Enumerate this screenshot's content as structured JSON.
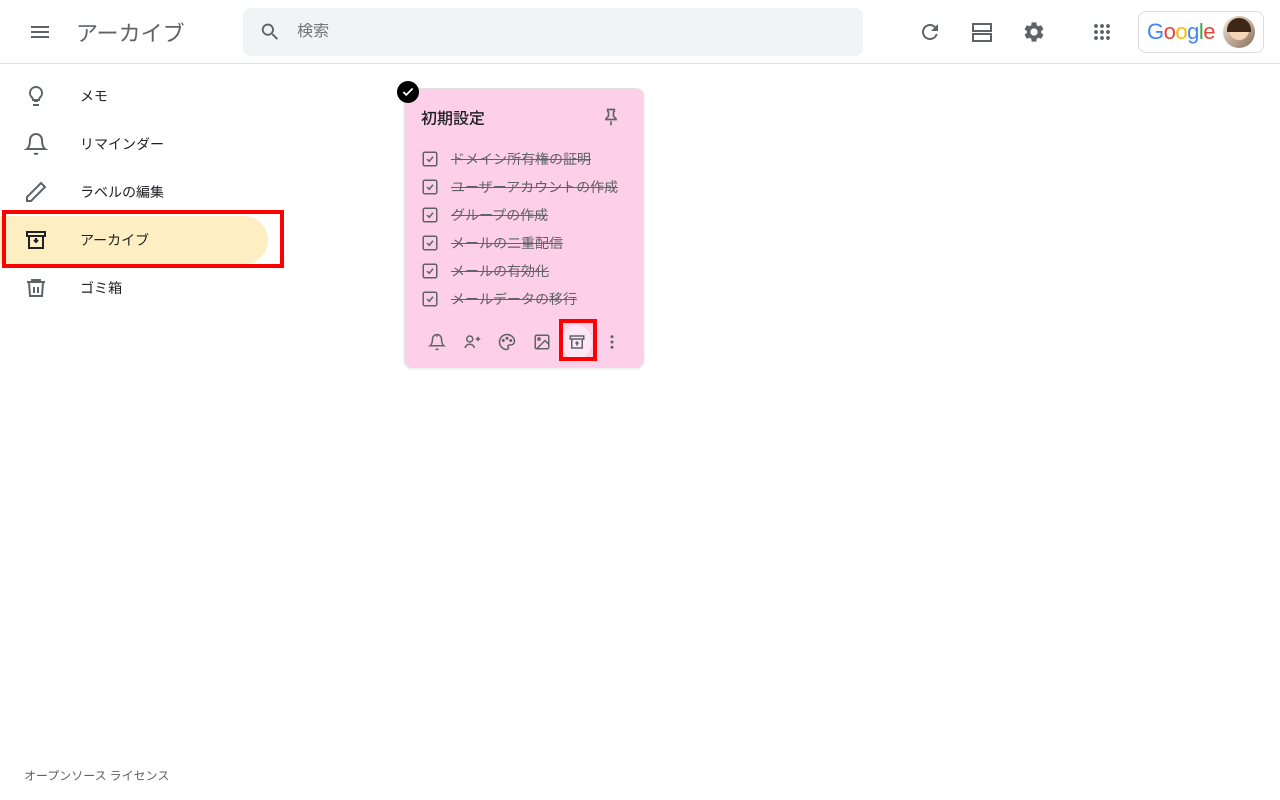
{
  "header": {
    "title": "アーカイブ",
    "search_placeholder": "検索",
    "logo": "Google"
  },
  "sidebar": {
    "items": [
      {
        "label": "メモ"
      },
      {
        "label": "リマインダー"
      },
      {
        "label": "ラベルの編集"
      },
      {
        "label": "アーカイブ"
      },
      {
        "label": "ゴミ箱"
      }
    ],
    "footer": "オープンソース ライセンス"
  },
  "note": {
    "title": "初期設定",
    "tasks": [
      "ドメイン所有権の証明",
      "ユーザーアカウントの作成",
      "グループの作成",
      "メールの二重配信",
      "メールの有効化",
      "メールデータの移行"
    ]
  }
}
